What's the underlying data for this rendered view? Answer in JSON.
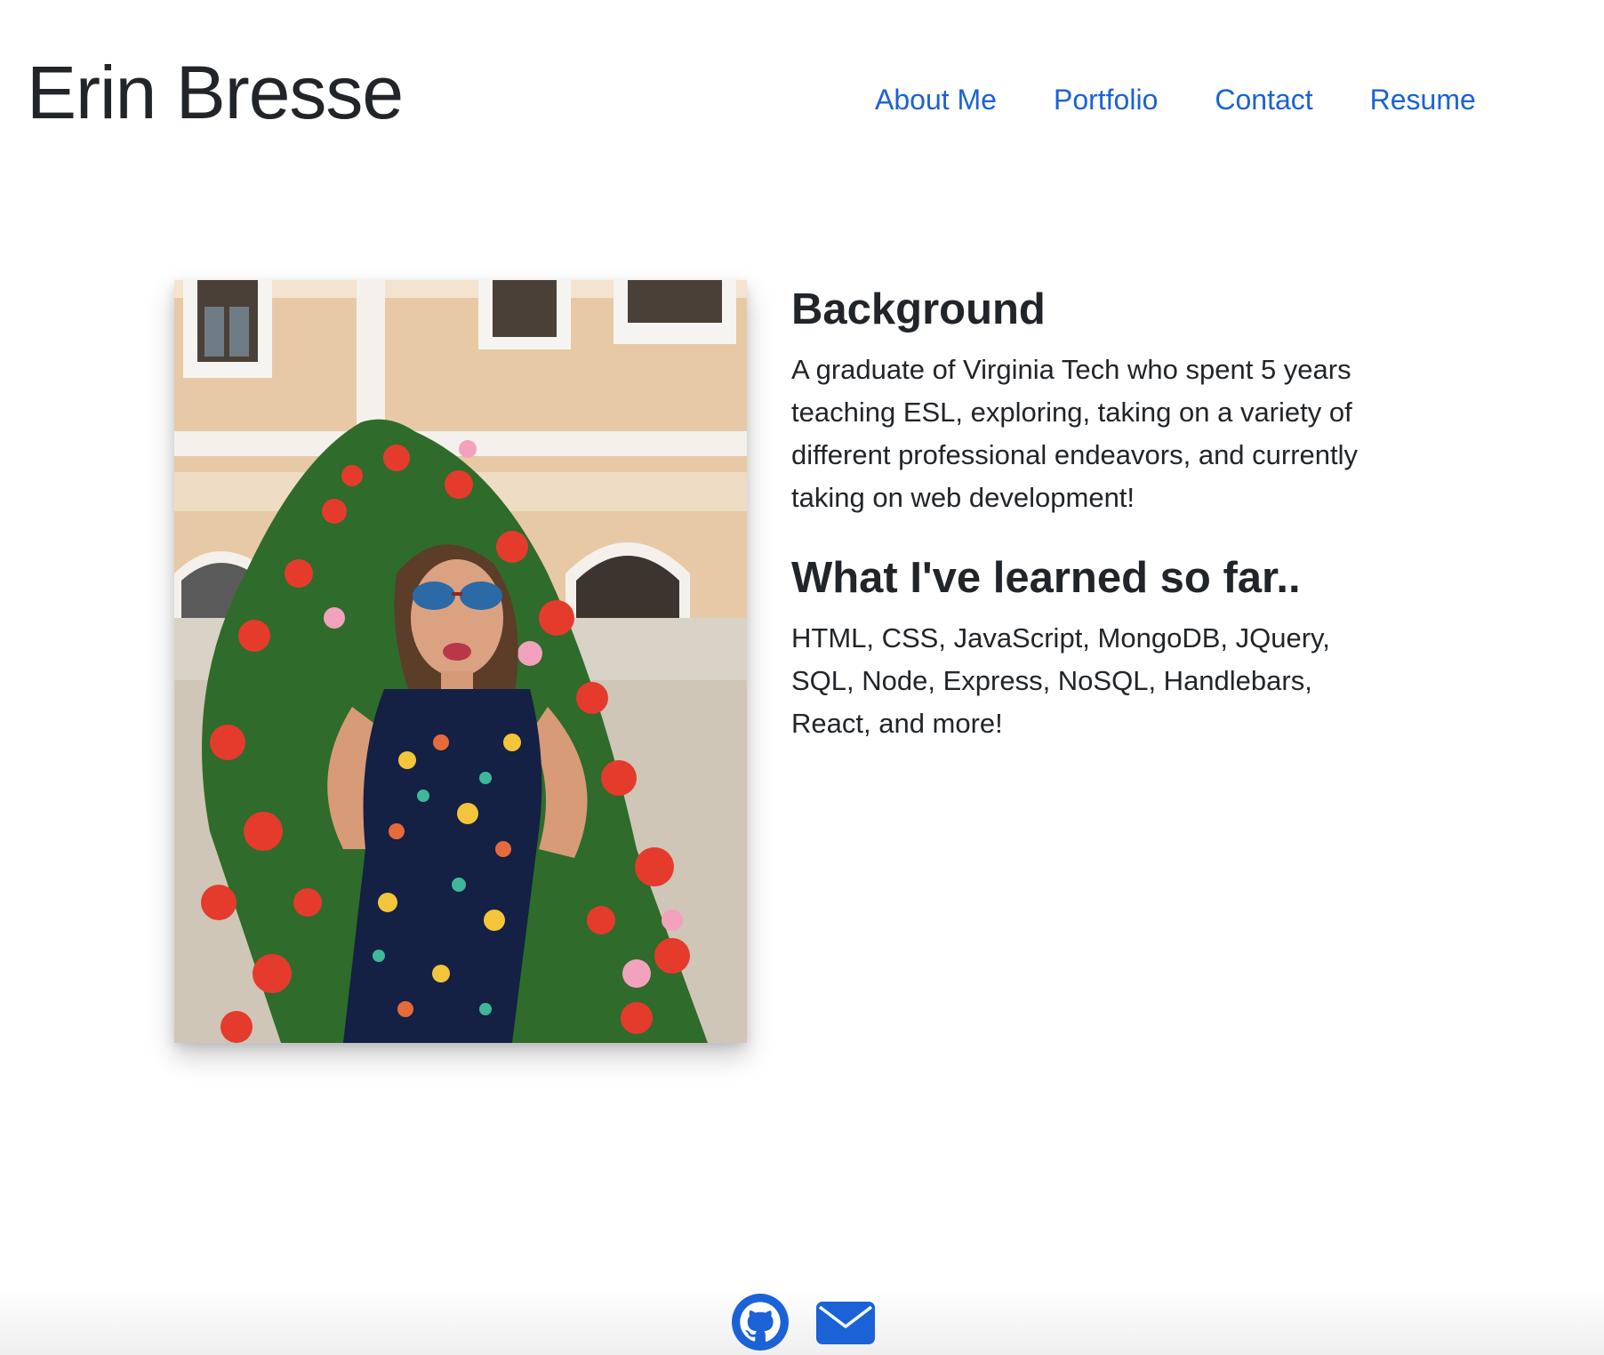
{
  "header": {
    "site_title": "Erin Bresse",
    "nav": [
      {
        "label": "About Me"
      },
      {
        "label": "Portfolio"
      },
      {
        "label": "Contact"
      },
      {
        "label": "Resume"
      }
    ]
  },
  "main": {
    "photo": {
      "icon": "portrait-photo"
    },
    "background": {
      "heading": "Background",
      "body": "A graduate of Virginia Tech who spent 5 years teaching ESL, exploring, taking on a variety of different professional endeavors, and currently taking on web development!"
    },
    "learned": {
      "heading": "What I've learned so far..",
      "body": "HTML, CSS, JavaScript, MongoDB, JQuery, SQL, Node, Express, NoSQL, Handlebars, React, and more!"
    }
  },
  "footer": {
    "icons": [
      {
        "name": "github-icon"
      },
      {
        "name": "envelope-icon"
      }
    ]
  },
  "colors": {
    "link": "#1a62d6",
    "text": "#212529",
    "icon": "#1a62d6"
  }
}
